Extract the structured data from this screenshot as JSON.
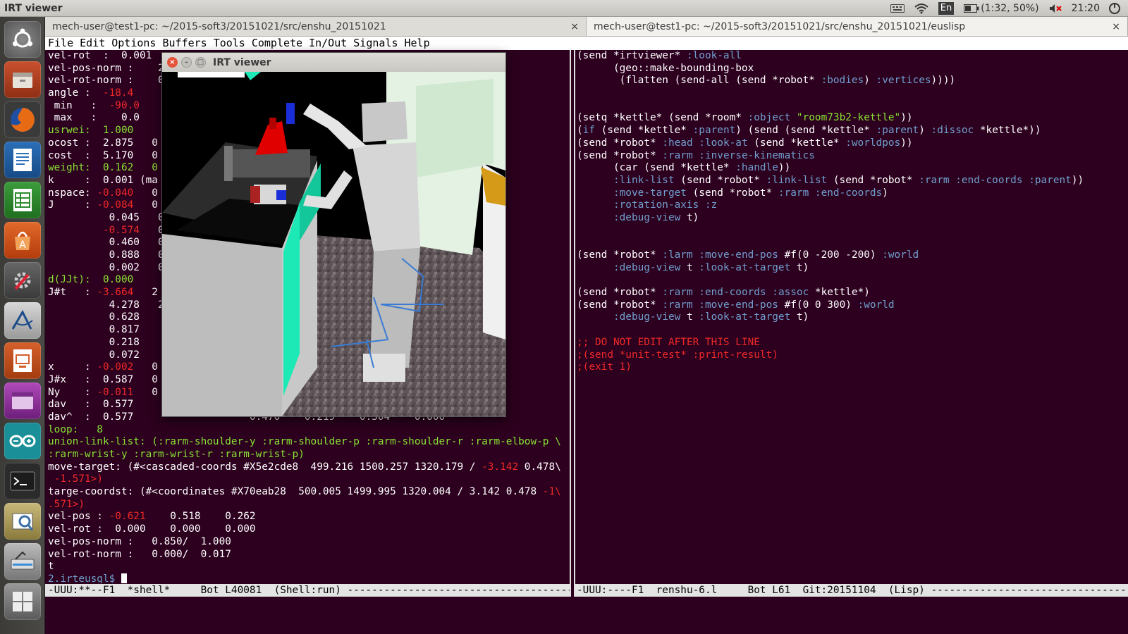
{
  "topbar": {
    "title": "IRT viewer",
    "lang": "En",
    "battery": "(1:32, 50%)",
    "clock": "21:20"
  },
  "launcher": {
    "items": [
      "ubuntu-dash",
      "files",
      "firefox",
      "writer",
      "calc",
      "impress-style",
      "software-center",
      "settings",
      "texmaker",
      "impress",
      "app-purple",
      "arduino",
      "terminal",
      "image-viewer",
      "scanner",
      "workspaces"
    ]
  },
  "tabs": [
    {
      "label": "mech-user@test1-pc: ~/2015-soft3/20151021/src/enshu_20151021",
      "close": "×"
    },
    {
      "label": "mech-user@test1-pc: ~/2015-soft3/20151021/src/enshu_20151021/euslisp",
      "close": "×"
    }
  ],
  "menu": [
    "File",
    "Edit",
    "Options",
    "Buffers",
    "Tools",
    "Complete",
    "In/Out",
    "Signals",
    "Help"
  ],
  "irt_window": {
    "title": "IRT viewer"
  },
  "left_lines": [
    [
      [
        "vel-rot  :  0.001",
        ""
      ]
    ],
    [
      [
        "vel-pos-norm :    2",
        ""
      ]
    ],
    [
      [
        "vel-rot-norm :    0",
        ""
      ]
    ],
    [
      [
        "angle :  ",
        ""
      ],
      [
        "-18.4",
        "r"
      ]
    ],
    [
      [
        " min   :  ",
        ""
      ],
      [
        "-90.0",
        "r"
      ]
    ],
    [
      [
        " max   :    0.0",
        ""
      ]
    ],
    [
      [
        "usrwei:  1.000",
        "g"
      ]
    ],
    [
      [
        "ocost :  2.875   0",
        ""
      ]
    ],
    [
      [
        "cost  :  5.170   0",
        ""
      ]
    ],
    [
      [
        "weight:  0.162   0",
        "g"
      ]
    ],
    [
      [
        "k     :  0.001 (ma",
        ""
      ]
    ],
    [
      [
        "nspace: ",
        ""
      ],
      [
        "-0.040",
        "r"
      ],
      [
        "   0",
        ""
      ]
    ],
    [
      [
        "J     : ",
        ""
      ],
      [
        "-0.084",
        "r"
      ],
      [
        "   0",
        ""
      ]
    ],
    [
      [
        "          0.045   0",
        ""
      ]
    ],
    [
      [
        "         ",
        ""
      ],
      [
        "-0.574",
        "r"
      ],
      [
        "   0",
        ""
      ]
    ],
    [
      [
        "          0.460   0",
        ""
      ]
    ],
    [
      [
        "          0.888   0",
        ""
      ]
    ],
    [
      [
        "          0.002   0",
        ""
      ]
    ],
    [
      [
        "d(JJt):  0.000",
        "g"
      ]
    ],
    [
      [
        "J#t   : ",
        ""
      ],
      [
        "-3.664",
        "r"
      ],
      [
        "   2",
        ""
      ]
    ],
    [
      [
        "          4.278   2",
        ""
      ]
    ],
    [
      [
        "          0.628   ",
        ""
      ]
    ],
    [
      [
        "          0.817   ",
        ""
      ]
    ],
    [
      [
        "          0.218   ",
        ""
      ]
    ],
    [
      [
        "          0.072   ",
        ""
      ]
    ],
    [
      [
        "x     : ",
        ""
      ],
      [
        "-0.002",
        "r"
      ],
      [
        "   0",
        ""
      ]
    ],
    [
      [
        "J#x   :  0.587   0",
        ""
      ]
    ],
    [
      [
        "Ny    : ",
        ""
      ],
      [
        "-0.011",
        "r"
      ],
      [
        "   0",
        ""
      ]
    ],
    [
      [
        "dav   :  0.577   ",
        ""
      ]
    ],
    [
      [
        "dav^  :  0.577                   0.470    0.219    0.304    0.000",
        ""
      ]
    ],
    [
      [
        "loop:   8",
        "g"
      ]
    ],
    [
      [
        "union-link-list: (:rarm-shoulder-y :rarm-shoulder-p :rarm-shoulder-r :rarm-elbow-p \\",
        "g"
      ]
    ],
    [
      [
        ":rarm-wrist-y :rarm-wrist-r :rarm-wrist-p)",
        "g"
      ]
    ],
    [
      [
        "move-target: (#<cascaded-coords #X5e2cde8  499.216 1500.257 1320.179 / ",
        ""
      ],
      [
        "-3.142",
        "r"
      ],
      [
        " 0.478\\",
        ""
      ]
    ],
    [
      [
        " ",
        ""
      ],
      [
        "-1.571>)",
        "r"
      ]
    ],
    [
      [
        "targe-coordst: (#<coordinates #X70eab28  500.005 1499.995 1320.004 / 3.142 0.478 ",
        ""
      ],
      [
        "-1\\",
        "r"
      ]
    ],
    [
      [
        ".571>)",
        "r"
      ]
    ],
    [
      [
        "vel-pos : ",
        ""
      ],
      [
        "-0.621",
        "r"
      ],
      [
        "    0.518    0.262",
        ""
      ]
    ],
    [
      [
        "vel-rot :  0.000    0.000    0.000",
        ""
      ]
    ],
    [
      [
        "vel-pos-norm :   0.850/  1.000",
        ""
      ]
    ],
    [
      [
        "vel-rot-norm :   0.000/  0.017",
        ""
      ]
    ],
    [
      [
        "t",
        ""
      ]
    ],
    [
      [
        "2.irteusgl$ ",
        "b"
      ]
    ]
  ],
  "right_lines": [
    [
      [
        "(send *irtviewer* ",
        ""
      ],
      [
        ":look-all",
        "kw"
      ]
    ],
    [
      [
        "      (geo::make-bounding-box",
        ""
      ]
    ],
    [
      [
        "       (flatten (send-all (send *robot* ",
        ""
      ],
      [
        ":bodies",
        "kw"
      ],
      [
        ") ",
        ""
      ],
      [
        ":vertices",
        "kw"
      ],
      [
        "))))",
        ""
      ]
    ],
    [
      [
        "",
        ""
      ]
    ],
    [
      [
        "",
        ""
      ]
    ],
    [
      [
        "(setq *kettle* (send *room* ",
        ""
      ],
      [
        ":object",
        "kw"
      ],
      [
        " ",
        ""
      ],
      [
        "\"room73b2-kettle\"",
        "str"
      ],
      [
        "))",
        ""
      ]
    ],
    [
      [
        "(",
        ""
      ],
      [
        "if",
        "kw"
      ],
      [
        " (send *kettle* ",
        ""
      ],
      [
        ":parent",
        "kw"
      ],
      [
        ") (send (send *kettle* ",
        ""
      ],
      [
        ":parent",
        "kw"
      ],
      [
        ") ",
        ""
      ],
      [
        ":dissoc",
        "kw"
      ],
      [
        " *kettle*))",
        ""
      ]
    ],
    [
      [
        "(send *robot* ",
        ""
      ],
      [
        ":head",
        "kw"
      ],
      [
        " ",
        ""
      ],
      [
        ":look-at",
        "kw"
      ],
      [
        " (send *kettle* ",
        ""
      ],
      [
        ":worldpos",
        "kw"
      ],
      [
        "))",
        ""
      ]
    ],
    [
      [
        "(send *robot* ",
        ""
      ],
      [
        ":rarm",
        "kw"
      ],
      [
        " ",
        ""
      ],
      [
        ":inverse-kinematics",
        "kw"
      ]
    ],
    [
      [
        "      (car (send *kettle* ",
        ""
      ],
      [
        ":handle",
        "kw"
      ],
      [
        "))",
        ""
      ]
    ],
    [
      [
        "      ",
        ""
      ],
      [
        ":link-list",
        "kw"
      ],
      [
        " (send *robot* ",
        ""
      ],
      [
        ":link-list",
        "kw"
      ],
      [
        " (send *robot* ",
        ""
      ],
      [
        ":rarm",
        "kw"
      ],
      [
        " ",
        ""
      ],
      [
        ":end-coords",
        "kw"
      ],
      [
        " ",
        ""
      ],
      [
        ":parent",
        "kw"
      ],
      [
        "))",
        ""
      ]
    ],
    [
      [
        "      ",
        ""
      ],
      [
        ":move-target",
        "kw"
      ],
      [
        " (send *robot* ",
        ""
      ],
      [
        ":rarm",
        "kw"
      ],
      [
        " ",
        ""
      ],
      [
        ":end-coords",
        "kw"
      ],
      [
        ")",
        ""
      ]
    ],
    [
      [
        "      ",
        ""
      ],
      [
        ":rotation-axis",
        "kw"
      ],
      [
        " ",
        ""
      ],
      [
        ":z",
        "kw"
      ]
    ],
    [
      [
        "      ",
        ""
      ],
      [
        ":debug-view",
        "kw"
      ],
      [
        " t)",
        ""
      ]
    ],
    [
      [
        "",
        ""
      ]
    ],
    [
      [
        "",
        ""
      ]
    ],
    [
      [
        "(send *robot* ",
        ""
      ],
      [
        ":larm",
        "kw"
      ],
      [
        " ",
        ""
      ],
      [
        ":move-end-pos",
        "kw"
      ],
      [
        " #f(0 -200 -200) ",
        ""
      ],
      [
        ":world",
        "kw"
      ]
    ],
    [
      [
        "      ",
        ""
      ],
      [
        ":debug-view",
        "kw"
      ],
      [
        " t ",
        ""
      ],
      [
        ":look-at-target",
        "kw"
      ],
      [
        " t)",
        ""
      ]
    ],
    [
      [
        "",
        ""
      ]
    ],
    [
      [
        "(send *robot* ",
        ""
      ],
      [
        ":rarm",
        "kw"
      ],
      [
        " ",
        ""
      ],
      [
        ":end-coords",
        "kw"
      ],
      [
        " ",
        ""
      ],
      [
        ":assoc",
        "kw"
      ],
      [
        " *kettle*)",
        ""
      ]
    ],
    [
      [
        "(send *robot* ",
        ""
      ],
      [
        ":rarm",
        "kw"
      ],
      [
        " ",
        ""
      ],
      [
        ":move-end-pos",
        "kw"
      ],
      [
        " #f(0 0 300) ",
        ""
      ],
      [
        ":world",
        "kw"
      ]
    ],
    [
      [
        "      ",
        ""
      ],
      [
        ":debug-view",
        "kw"
      ],
      [
        " t ",
        ""
      ],
      [
        ":look-at-target",
        "kw"
      ],
      [
        " t)",
        ""
      ]
    ],
    [
      [
        "",
        ""
      ]
    ],
    [
      [
        ";; DO NOT EDIT AFTER THIS LINE",
        "red"
      ]
    ],
    [
      [
        ";(send *unit-test* :print-result)",
        "red"
      ]
    ],
    [
      [
        ";(exit 1)",
        "red"
      ]
    ]
  ],
  "modeline_left": "-UUU:**--F1  *shell*     Bot L40081  (Shell:run) ---------------------------------------------",
  "modeline_right": "-UUU:----F1  renshu-6.l     Bot L61  Git:20151104  (Lisp) ------------------------------------------------"
}
